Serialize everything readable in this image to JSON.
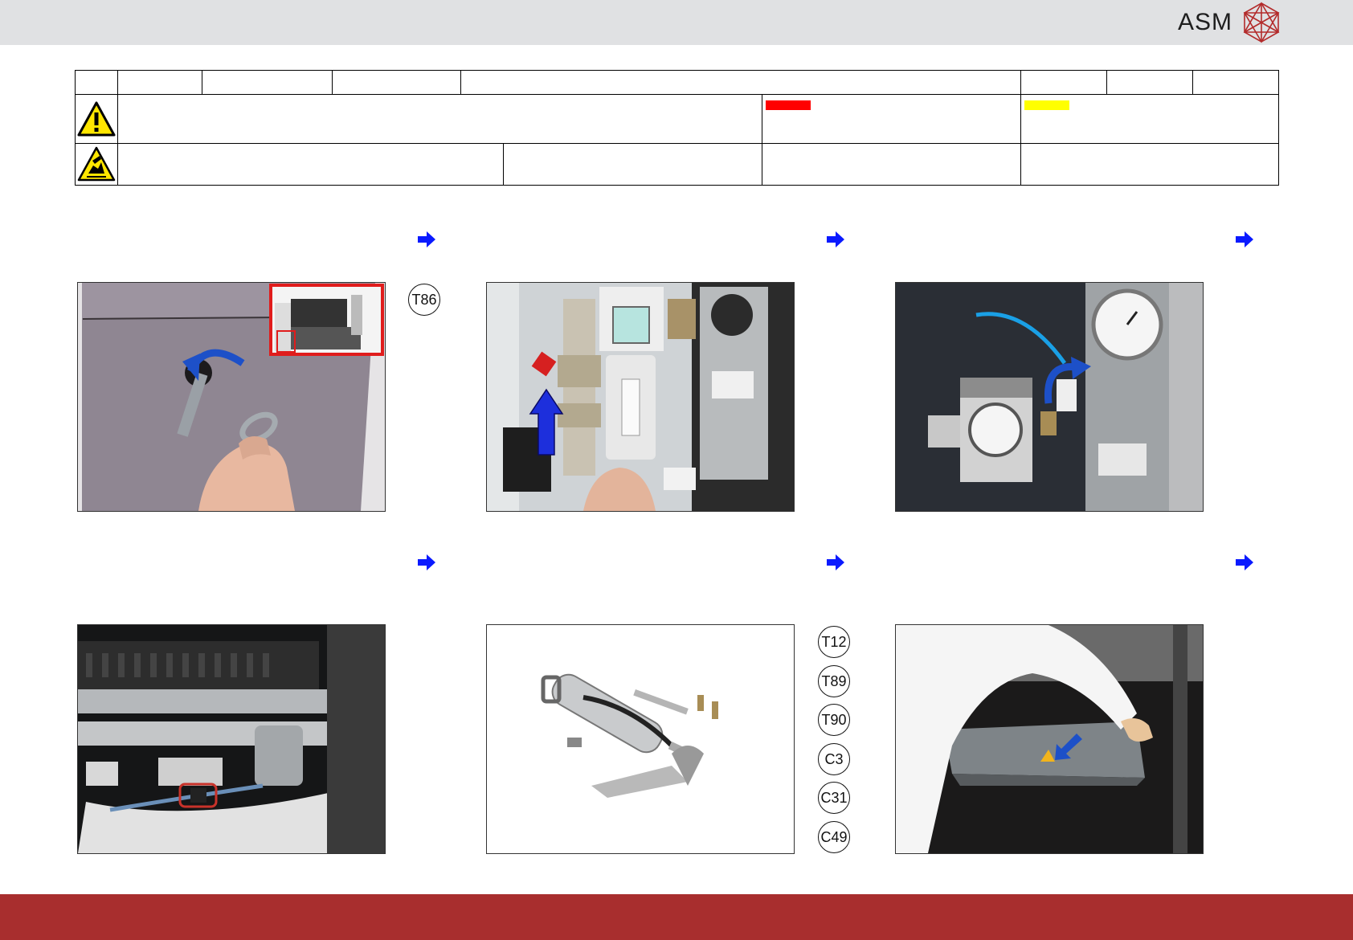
{
  "header": {
    "logo_text": "ASM"
  },
  "safety": {
    "warning_color": "#ff0000",
    "caution_color": "#ffff00"
  },
  "tools": {
    "step1": [
      "T86"
    ],
    "step5": [
      "T12",
      "T89",
      "T90",
      "C3",
      "C31",
      "C49"
    ]
  },
  "colors": {
    "accent_arrow": "#0a1aff",
    "footer": "#a82e2e",
    "topbar": "#e0e1e3"
  },
  "icons": [
    "warning-triangle-icon",
    "esd-icon",
    "next-step-arrow-icon",
    "asm-logo-icon"
  ]
}
